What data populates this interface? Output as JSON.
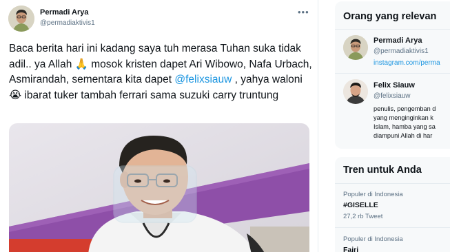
{
  "tweet": {
    "author_name": "Permadi Arya",
    "author_handle": "@permadiaktivis1",
    "more_label": "•••",
    "text_before_mention": "Baca berita hari ini kadang saya tuh merasa Tuhan suka tidak adil.. ya Allah 🙏  mosok kristen dapet Ari Wibowo, Nafa Urbach, Asmirandah, sementara kita dapet ",
    "mention": "@felixsiauw",
    "text_after_mention": " , yahya waloni 😭 ibarat tuker tambah ferrari sama suzuki carry truntung"
  },
  "sidebar": {
    "relevant": {
      "title": "Orang yang relevan",
      "people": [
        {
          "name": "Permadi Arya",
          "handle": "@permadiaktivis1",
          "link": "instagram.com/perma"
        },
        {
          "name": "Felix Siauw",
          "handle": "@felixsiauw",
          "bio_lines": [
            "penulis, pengemban d",
            "yang menginginkan k",
            "Islam, hamba yang sa",
            "diampuni Allah di har"
          ]
        }
      ]
    },
    "trends": {
      "title": "Tren untuk Anda",
      "items": [
        {
          "context": "Populer di Indonesia",
          "name": "#GISELLE",
          "count": "27,2 rb Tweet"
        },
        {
          "context": "Populer di Indonesia",
          "name": "Fajri"
        }
      ]
    }
  }
}
